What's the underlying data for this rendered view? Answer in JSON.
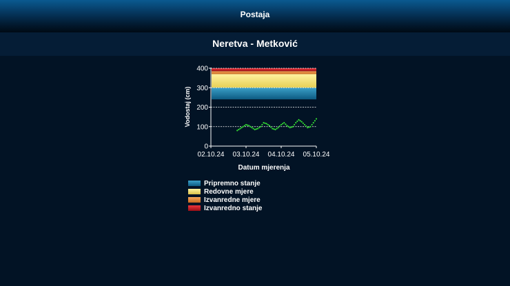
{
  "header": {
    "title": "Postaja"
  },
  "station": {
    "name": "Neretva - Metković"
  },
  "colors": {
    "pripremno": "#1b7fa8",
    "redovne": "#f2e07a",
    "izvanredne_mjere": "#e58b3b",
    "izvanredno_stanje": "#d0202a",
    "series": "#33dd33"
  },
  "chart_data": {
    "type": "line",
    "xlabel": "Datum mjerenja",
    "ylabel": "Vodostaj (cm)",
    "x_ticks": [
      "02.10.24",
      "03.10.24",
      "04.10.24",
      "05.10.24"
    ],
    "y_ticks": [
      "0",
      "100",
      "200",
      "300",
      "400"
    ],
    "ylim": [
      0,
      400
    ],
    "xlim": [
      "2024-10-02",
      "2024-10-05"
    ],
    "bands": [
      {
        "name": "Pripremno stanje",
        "from": 240,
        "to": 300,
        "color": "#1b7fa8"
      },
      {
        "name": "Redovne mjere",
        "from": 300,
        "to": 370,
        "color": "#f2e07a"
      },
      {
        "name": "Izvanredne mjere",
        "from": 370,
        "to": 385,
        "color": "#e58b3b"
      },
      {
        "name": "Izvanredno stanje",
        "from": 385,
        "to": 400,
        "color": "#d0202a"
      }
    ],
    "series": [
      {
        "x": [
          "2024-10-02 18:00",
          "2024-10-02 20:00",
          "2024-10-02 22:00",
          "2024-10-03 00:00",
          "2024-10-03 02:00",
          "2024-10-03 04:00",
          "2024-10-03 06:00",
          "2024-10-03 08:00",
          "2024-10-03 10:00",
          "2024-10-03 12:00",
          "2024-10-03 14:00",
          "2024-10-03 16:00",
          "2024-10-03 18:00",
          "2024-10-03 20:00",
          "2024-10-03 22:00",
          "2024-10-04 00:00",
          "2024-10-04 02:00",
          "2024-10-04 04:00",
          "2024-10-04 06:00",
          "2024-10-04 08:00",
          "2024-10-04 10:00",
          "2024-10-04 12:00",
          "2024-10-04 14:00",
          "2024-10-04 16:00",
          "2024-10-04 18:00",
          "2024-10-04 20:00",
          "2024-10-04 22:00",
          "2024-10-05 00:00"
        ],
        "values": [
          80,
          90,
          100,
          110,
          105,
          95,
          85,
          90,
          100,
          120,
          115,
          105,
          90,
          85,
          95,
          110,
          120,
          105,
          95,
          100,
          120,
          135,
          125,
          110,
          95,
          100,
          120,
          140
        ]
      }
    ],
    "legend": [
      "Pripremno stanje",
      "Redovne mjere",
      "Izvanredne mjere",
      "Izvanredno stanje"
    ],
    "grid": true
  }
}
